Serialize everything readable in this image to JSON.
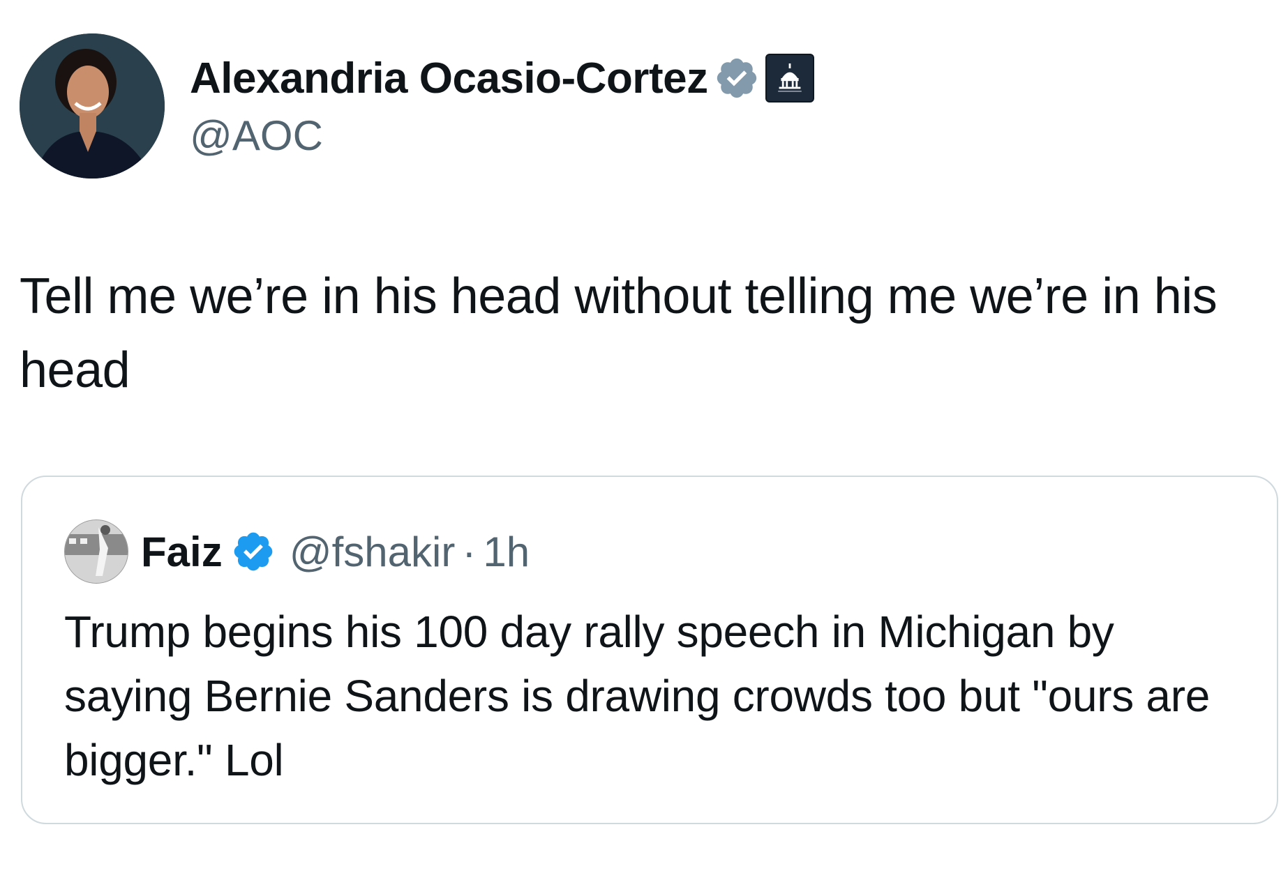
{
  "tweet": {
    "author": {
      "display_name": "Alexandria Ocasio-Cortez",
      "handle": "@AOC",
      "verified_badge": "grey-verified-icon",
      "affiliation_badge": "capitol-dome-icon"
    },
    "text": "Tell me we’re in his head without telling me we’re in his head"
  },
  "quote": {
    "author": {
      "display_name": "Faiz",
      "handle": "@fshakir",
      "separator": "·",
      "time": "1h",
      "verified_badge": "blue-verified-icon"
    },
    "text": "Trump begins his 100 day rally speech in Michigan by saying Bernie Sanders is drawing crowds too but \"ours are bigger.\" Lol"
  },
  "colors": {
    "text_primary": "#0f1419",
    "text_secondary": "#536471",
    "verified_blue": "#1d9bf0",
    "verified_grey": "#829aab",
    "card_border": "#cfd9de"
  }
}
